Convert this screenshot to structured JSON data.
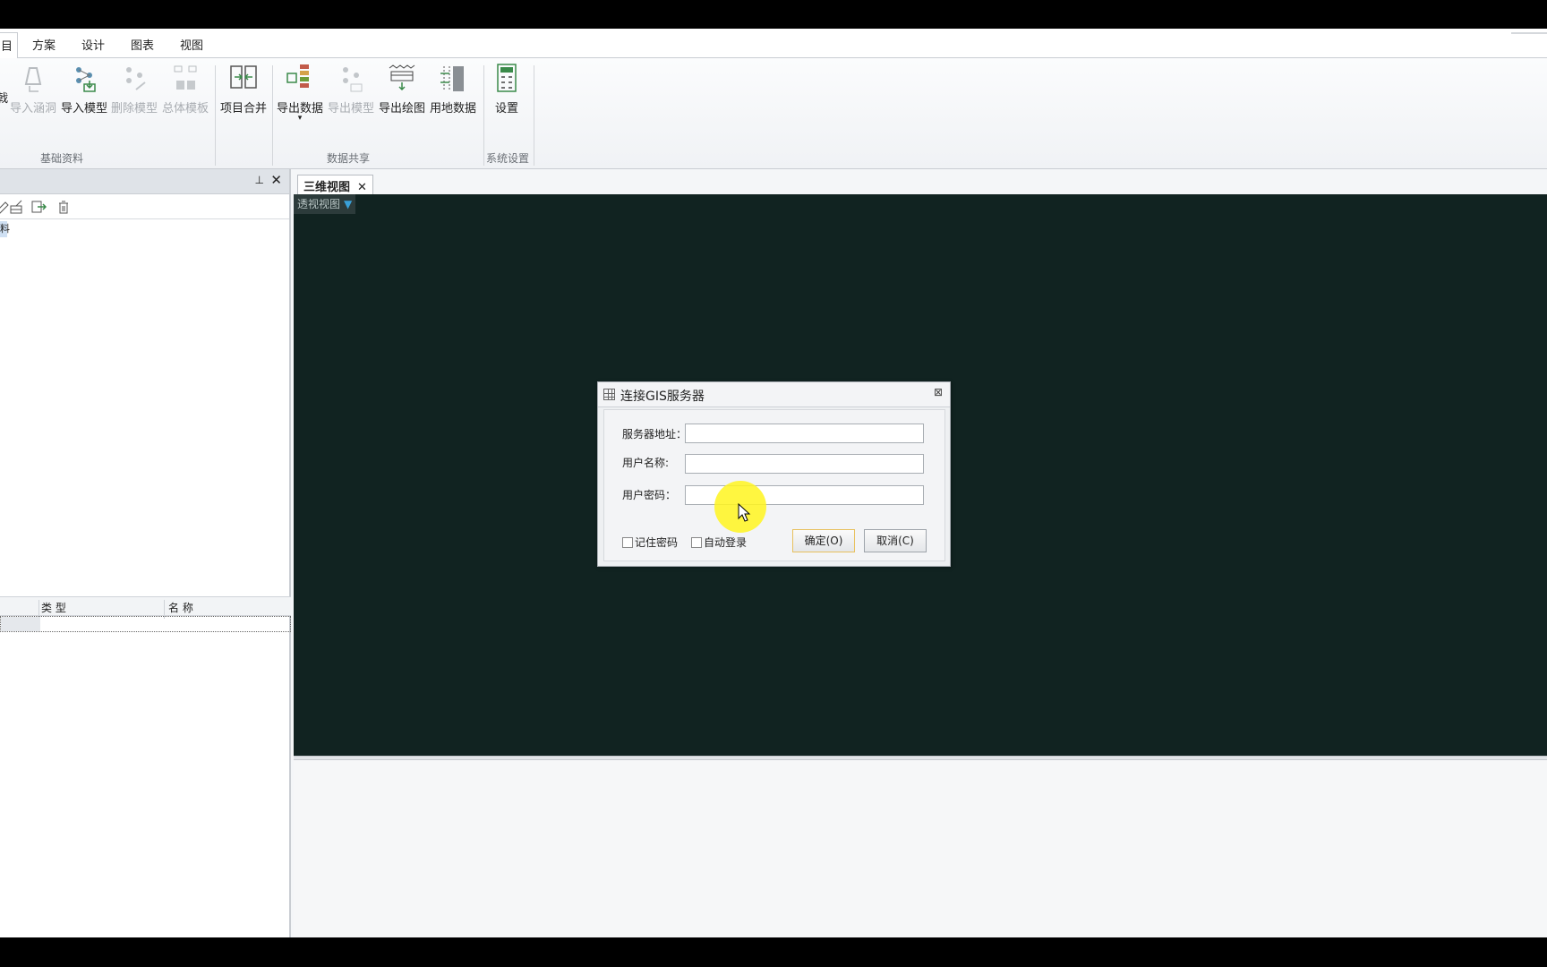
{
  "menu": {
    "tabs": [
      "目",
      "方案",
      "设计",
      "图表",
      "视图"
    ]
  },
  "ribbon": {
    "groups": [
      {
        "label": "基础资料"
      },
      {
        "label": "数据共享"
      },
      {
        "label": "系统设置"
      }
    ],
    "buttons": {
      "partial": "戟",
      "import_culvert": "导入涵洞",
      "import_model": "导入模型",
      "delete_model": "删除模型",
      "overall_template": "总体模板",
      "project_merge": "项目合并",
      "export_data": "导出数据",
      "export_model": "导出模型",
      "export_drawing": "导出绘图",
      "land_data": "用地数据",
      "settings": "设置"
    }
  },
  "left_panel": {
    "tree_item": "料",
    "grid_headers": [
      "类 型",
      "名 称"
    ]
  },
  "document": {
    "tab_label": "三维视图",
    "view_combo": "透视视图"
  },
  "dialog": {
    "title": "连接GIS服务器",
    "server_label": "服务器地址：",
    "server_value": "",
    "user_label": "用户名称:",
    "user_value": "",
    "password_label": "用户密码：",
    "password_value": "",
    "remember_label": "记住密码",
    "autologin_label": "自动登录",
    "ok_label": "确定(O)",
    "cancel_label": "取消(C)"
  },
  "colors": {
    "viewport_bg": "#112321",
    "accent": "#39a0d8"
  }
}
